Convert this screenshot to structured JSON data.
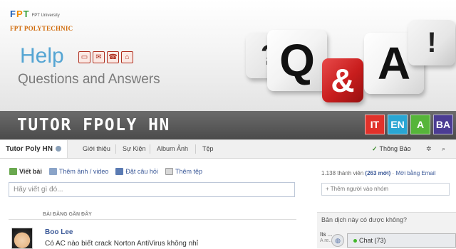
{
  "banner": {
    "logo_letters": [
      "F",
      "P",
      "T"
    ],
    "logo_university": "FPT University",
    "logo_name": "FPT POLYTECHNIC",
    "help_title": "Help",
    "help_subtitle": "Questions and Answers",
    "help_icons": [
      "monitor-icon",
      "mail-icon",
      "phone-icon",
      "home-icon"
    ],
    "dice": [
      "?",
      "Q",
      "&",
      "A",
      "!"
    ]
  },
  "tutor_bar": {
    "title": "TUTOR FPOLY HN",
    "languages": [
      {
        "label": "IT",
        "color": "#e0312a"
      },
      {
        "label": "EN",
        "color": "#29a6d3"
      },
      {
        "label": "A",
        "color": "#56b53a"
      },
      {
        "label": "BA",
        "color": "#4b3c93"
      }
    ]
  },
  "nav": {
    "active_tab": "Tutor Poly HN",
    "tabs": [
      "Giới thiệu",
      "Sự Kiện",
      "Album Ảnh",
      "Tệp"
    ],
    "notifications": "Thông Báo"
  },
  "composer": {
    "actions": [
      "Viết bài",
      "Thêm ảnh / video",
      "Đặt câu hỏi",
      "Thêm tệp"
    ],
    "placeholder": "Hãy viết gì đó..."
  },
  "feed": {
    "section_label": "BÀI ĐĂNG GẦN ĐÂY",
    "post_author": "Boo Lee",
    "post_text": "Có AC nào biết crack Norton AntiVirus không nhỉ"
  },
  "sidebar": {
    "members_count": "1.138 thành viên",
    "members_new": "(263 mới)",
    "members_sep": " · ",
    "invite_link": "Mời bằng Email",
    "add_person_placeholder": "+ Thêm người vào nhóm",
    "translate_question": "Bản dịch này có được không?",
    "translate_line1": "Its ...",
    "translate_line2": "A re..."
  },
  "chat": {
    "label": "Chat (73)"
  },
  "colors": {
    "accent": "#3b5998",
    "help_blue": "#55a5d3",
    "dice_red": "#c81d1d"
  }
}
